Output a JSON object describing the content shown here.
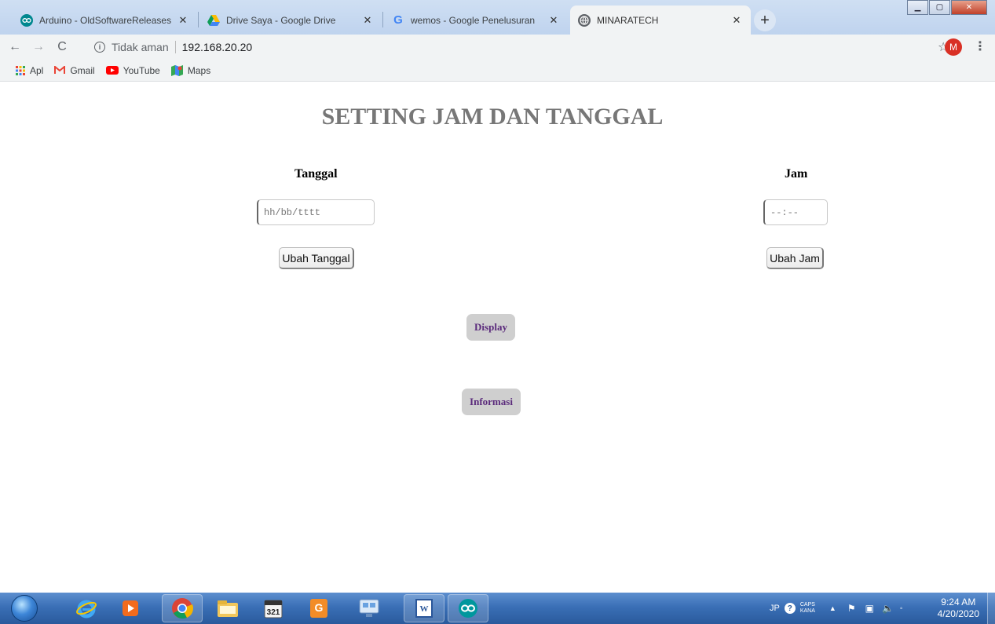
{
  "browser": {
    "tabs": [
      {
        "title": "Arduino - OldSoftwareReleases",
        "favicon": "arduino-icon",
        "active": false
      },
      {
        "title": "Drive Saya - Google Drive",
        "favicon": "google-drive-icon",
        "active": false
      },
      {
        "title": "wemos - Google Penelusuran",
        "favicon": "google-icon",
        "active": false
      },
      {
        "title": "MINARATECH",
        "favicon": "globe-icon",
        "active": true
      }
    ],
    "address": {
      "security_label": "Tidak aman",
      "url": "192.168.20.20"
    },
    "profile_initial": "M",
    "bookmarks": [
      {
        "label": "Apl",
        "icon": "apps-grid-icon"
      },
      {
        "label": "Gmail",
        "icon": "gmail-icon"
      },
      {
        "label": "YouTube",
        "icon": "youtube-icon"
      },
      {
        "label": "Maps",
        "icon": "maps-icon"
      }
    ]
  },
  "page": {
    "title": "SETTING JAM DAN TANGGAL",
    "date": {
      "label": "Tanggal",
      "placeholder": "hh/bb/tttt",
      "button": "Ubah Tanggal"
    },
    "time": {
      "label": "Jam",
      "placeholder": "--:--",
      "button": "Ubah Jam"
    },
    "display_button": "Display",
    "info_button": "Informasi"
  },
  "taskbar": {
    "apps": [
      "internet-explorer-icon",
      "media-player-icon",
      "chrome-icon",
      "file-explorer-icon",
      "calendar-icon",
      "pdf-icon",
      "network-icon",
      "word-icon",
      "arduino-icon"
    ],
    "tray": {
      "language": "JP",
      "caps": "CAPS",
      "kana": "KANA",
      "time": "9:24 AM",
      "date": "4/20/2020"
    }
  },
  "colors": {
    "title": "#777777",
    "pill_bg": "#cfcfcf",
    "pill_text": "#5b2b7c",
    "taskbar": "#3a6fb6"
  }
}
